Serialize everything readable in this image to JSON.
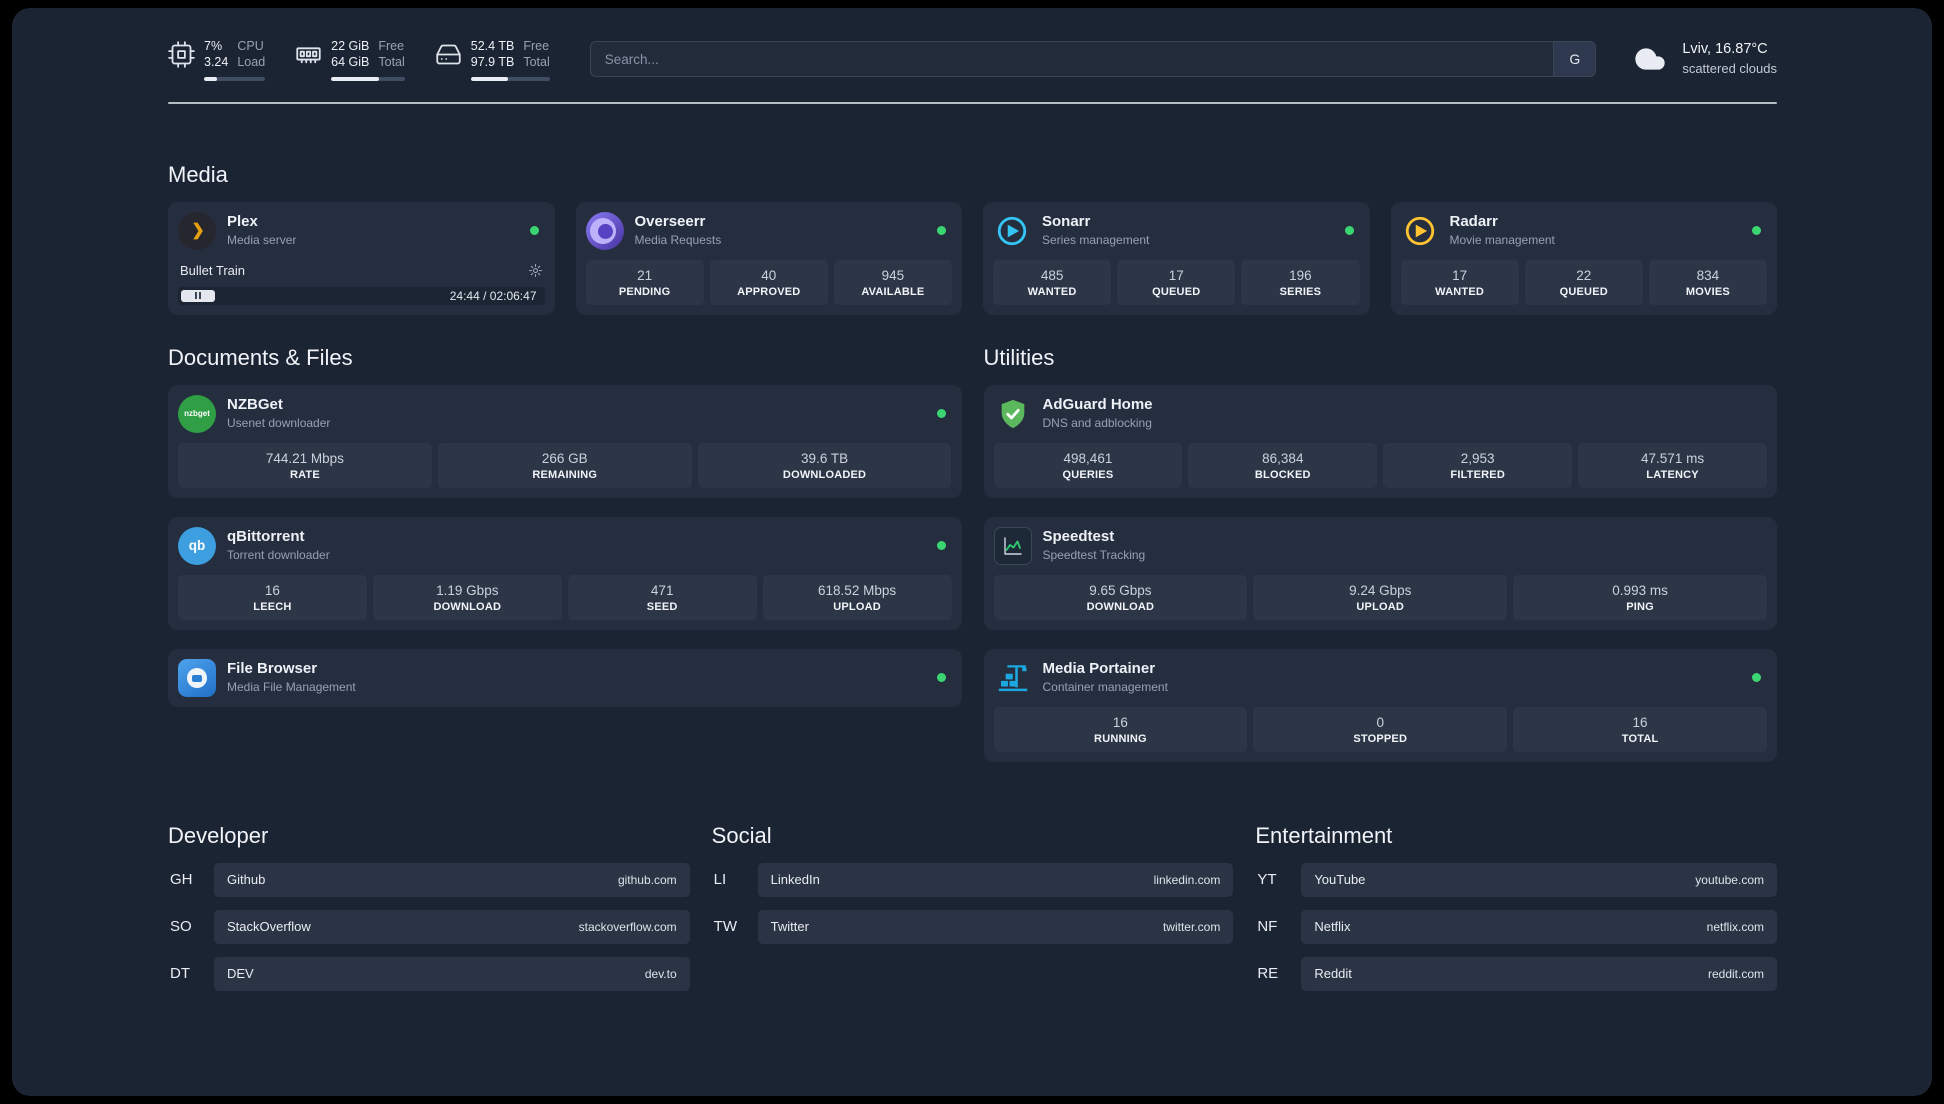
{
  "colors": {
    "background": "#1b2433",
    "card": "#252e3f",
    "tile": "#2c3647",
    "status_online": "#3bd671",
    "plex_brand": "#e5a00d",
    "sonarr_brand": "#35c5f4",
    "radarr_brand": "#ffc230",
    "nzbget_brand": "#2f9e44",
    "qbittorrent_brand": "#3d9fe0",
    "adguard_brand": "#5cb85c",
    "portainer_brand": "#1ba8e0"
  },
  "header": {
    "cpu": {
      "icon": "cpu-chip-icon",
      "value_top": "7%",
      "value_bottom": "3.24",
      "label_top": "CPU",
      "label_bottom": "Load",
      "bar_percent": 22
    },
    "ram": {
      "icon": "ram-icon",
      "value_top": "22 GiB",
      "value_bottom": "64 GiB",
      "label_top": "Free",
      "label_bottom": "Total",
      "bar_percent": 65
    },
    "disk": {
      "icon": "hard-drive-icon",
      "value_top": "52.4 TB",
      "value_bottom": "97.9 TB",
      "label_top": "Free",
      "label_bottom": "Total",
      "bar_percent": 47
    },
    "search": {
      "placeholder": "Search...",
      "engine_button": "G"
    },
    "weather": {
      "icon": "cloud-icon",
      "location": "Lviv, 16.87°C",
      "condition": "scattered clouds"
    }
  },
  "sections": {
    "media": {
      "title": "Media",
      "plex": {
        "icon": "plex-icon",
        "name": "Plex",
        "subtitle": "Media server",
        "status": "online",
        "now_playing": "Bullet Train",
        "time": "24:44 / 02:06:47",
        "progress_percent": 20
      },
      "overseerr": {
        "icon": "overseerr-icon",
        "name": "Overseerr",
        "subtitle": "Media Requests",
        "status": "online",
        "stats": [
          {
            "value": "21",
            "label": "PENDING"
          },
          {
            "value": "40",
            "label": "APPROVED"
          },
          {
            "value": "945",
            "label": "AVAILABLE"
          }
        ]
      },
      "sonarr": {
        "icon": "sonarr-icon",
        "name": "Sonarr",
        "subtitle": "Series management",
        "status": "online",
        "stats": [
          {
            "value": "485",
            "label": "WANTED"
          },
          {
            "value": "17",
            "label": "QUEUED"
          },
          {
            "value": "196",
            "label": "SERIES"
          }
        ]
      },
      "radarr": {
        "icon": "radarr-icon",
        "name": "Radarr",
        "subtitle": "Movie management",
        "status": "online",
        "stats": [
          {
            "value": "17",
            "label": "WANTED"
          },
          {
            "value": "22",
            "label": "QUEUED"
          },
          {
            "value": "834",
            "label": "MOVIES"
          }
        ]
      }
    },
    "documents": {
      "title": "Documents & Files",
      "nzbget": {
        "icon": "nzbget-icon",
        "icon_text": "nzbget",
        "name": "NZBGet",
        "subtitle": "Usenet downloader",
        "status": "online",
        "stats": [
          {
            "value": "744.21 Mbps",
            "label": "RATE"
          },
          {
            "value": "266 GB",
            "label": "REMAINING"
          },
          {
            "value": "39.6 TB",
            "label": "DOWNLOADED"
          }
        ]
      },
      "qbittorrent": {
        "icon": "qbittorrent-icon",
        "icon_text": "qb",
        "name": "qBittorrent",
        "subtitle": "Torrent downloader",
        "status": "online",
        "stats": [
          {
            "value": "16",
            "label": "LEECH"
          },
          {
            "value": "1.19 Gbps",
            "label": "DOWNLOAD"
          },
          {
            "value": "471",
            "label": "SEED"
          },
          {
            "value": "618.52 Mbps",
            "label": "UPLOAD"
          }
        ]
      },
      "filebrowser": {
        "icon": "filebrowser-icon",
        "name": "File Browser",
        "subtitle": "Media File Management",
        "status": "online"
      }
    },
    "utilities": {
      "title": "Utilities",
      "adguard": {
        "icon": "adguard-shield-icon",
        "name": "AdGuard Home",
        "subtitle": "DNS and adblocking",
        "stats": [
          {
            "value": "498,461",
            "label": "QUERIES"
          },
          {
            "value": "86,384",
            "label": "BLOCKED"
          },
          {
            "value": "2,953",
            "label": "FILTERED"
          },
          {
            "value": "47.571 ms",
            "label": "LATENCY"
          }
        ]
      },
      "speedtest": {
        "icon": "speedtest-chart-icon",
        "name": "Speedtest",
        "subtitle": "Speedtest Tracking",
        "stats": [
          {
            "value": "9.65 Gbps",
            "label": "DOWNLOAD"
          },
          {
            "value": "9.24 Gbps",
            "label": "UPLOAD"
          },
          {
            "value": "0.993 ms",
            "label": "PING"
          }
        ]
      },
      "portainer": {
        "icon": "portainer-icon",
        "name": "Media Portainer",
        "subtitle": "Container management",
        "status": "online",
        "stats": [
          {
            "value": "16",
            "label": "RUNNING"
          },
          {
            "value": "0",
            "label": "STOPPED"
          },
          {
            "value": "16",
            "label": "TOTAL"
          }
        ]
      }
    },
    "bookmarks": {
      "developer": {
        "title": "Developer",
        "items": [
          {
            "abbr": "GH",
            "name": "Github",
            "url": "github.com"
          },
          {
            "abbr": "SO",
            "name": "StackOverflow",
            "url": "stackoverflow.com"
          },
          {
            "abbr": "DT",
            "name": "DEV",
            "url": "dev.to"
          }
        ]
      },
      "social": {
        "title": "Social",
        "items": [
          {
            "abbr": "LI",
            "name": "LinkedIn",
            "url": "linkedin.com"
          },
          {
            "abbr": "TW",
            "name": "Twitter",
            "url": "twitter.com"
          }
        ]
      },
      "entertainment": {
        "title": "Entertainment",
        "items": [
          {
            "abbr": "YT",
            "name": "YouTube",
            "url": "youtube.com"
          },
          {
            "abbr": "NF",
            "name": "Netflix",
            "url": "netflix.com"
          },
          {
            "abbr": "RE",
            "name": "Reddit",
            "url": "reddit.com"
          }
        ]
      }
    }
  }
}
